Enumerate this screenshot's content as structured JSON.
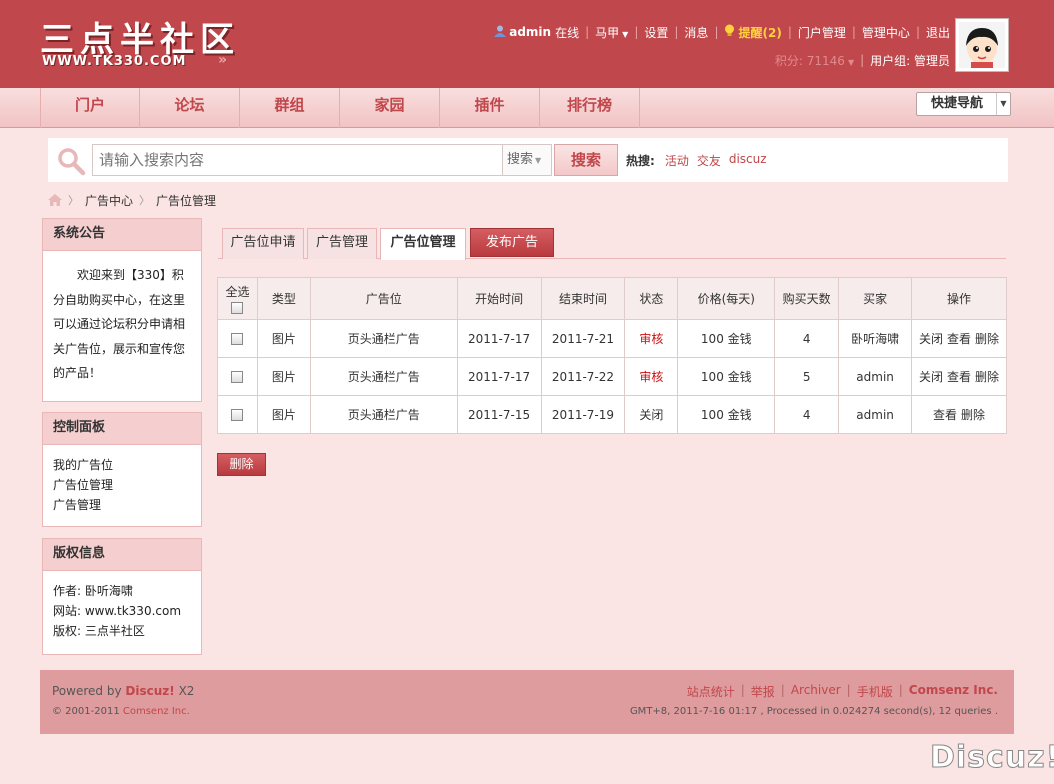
{
  "logo": {
    "text": "三点半社区",
    "url": "WWW.TK330.COM",
    "arrow": "»"
  },
  "usernav": {
    "user": "admin",
    "online": "在线",
    "majia": "马甲",
    "settings": "设置",
    "messages": "消息",
    "alerts": "提醒(2)",
    "portal_manage": "门户管理",
    "admin_center": "管理中心",
    "logout": "退出",
    "credits": "积分: 71146",
    "usergroup": "用户组: 管理员"
  },
  "nav": {
    "items": [
      "门户",
      "论坛",
      "群组",
      "家园",
      "插件",
      "排行榜"
    ],
    "quick_nav": "快捷导航"
  },
  "search": {
    "placeholder": "请输入搜索内容",
    "select_value": "搜索",
    "button": "搜索",
    "hot_label": "热搜:",
    "hot_links": [
      "活动",
      "交友",
      "discuz"
    ]
  },
  "breadcrumb": [
    "广告中心",
    "广告位管理"
  ],
  "sidebar": {
    "notice": {
      "title": "系统公告",
      "body": "欢迎来到【330】积分自助购买中心，在这里可以通过论坛积分申请相关广告位，展示和宣传您的产品！"
    },
    "panel": {
      "title": "控制面板",
      "links": [
        "我的广告位",
        "广告位管理",
        "广告管理"
      ]
    },
    "copyright": {
      "title": "版权信息",
      "lines": [
        "作者: 卧听海啸",
        "网站: www.tk330.com",
        "版权: 三点半社区"
      ]
    }
  },
  "tabs": {
    "apply": "广告位申请",
    "ad_manage": "广告管理",
    "pos_manage": "广告位管理",
    "publish": "发布广告"
  },
  "table": {
    "headers": [
      "全选",
      "类型",
      "广告位",
      "开始时间",
      "结束时间",
      "状态",
      "价格(每天)",
      "购买天数",
      "买家",
      "操作"
    ],
    "rows": [
      {
        "type": "图片",
        "position": "页头通栏广告",
        "start": "2011-7-17",
        "end": "2011-7-21",
        "status": "审核",
        "status_color": "#cc1111",
        "price": "100 金钱",
        "days": "4",
        "buyer": "卧听海啸",
        "ops": [
          "关闭",
          "查看",
          "删除"
        ]
      },
      {
        "type": "图片",
        "position": "页头通栏广告",
        "start": "2011-7-17",
        "end": "2011-7-22",
        "status": "审核",
        "status_color": "#cc1111",
        "price": "100 金钱",
        "days": "5",
        "buyer": "admin",
        "ops": [
          "关闭",
          "查看",
          "删除"
        ]
      },
      {
        "type": "图片",
        "position": "页头通栏广告",
        "start": "2011-7-15",
        "end": "2011-7-19",
        "status": "关闭",
        "status_color": "#333333",
        "price": "100 金钱",
        "days": "4",
        "buyer": "admin",
        "ops": [
          "查看",
          "删除"
        ]
      }
    ],
    "delete_button": "删除"
  },
  "footer": {
    "powered_prefix": "Powered by",
    "powered_brand": "Discuz!",
    "powered_version": "X2",
    "copyright_prefix": "© 2001-2011",
    "copyright_brand": "Comsenz Inc.",
    "links": [
      "站点统计",
      "举报",
      "Archiver",
      "手机版",
      "Comsenz Inc."
    ],
    "info": "GMT+8, 2011-7-16 01:17 , Processed in 0.024274 second(s), 12 queries ."
  },
  "watermark": "Discuz!",
  "colors": {
    "header": "#c0474b",
    "accent": "#c0474b",
    "background": "#fbe4e4"
  }
}
